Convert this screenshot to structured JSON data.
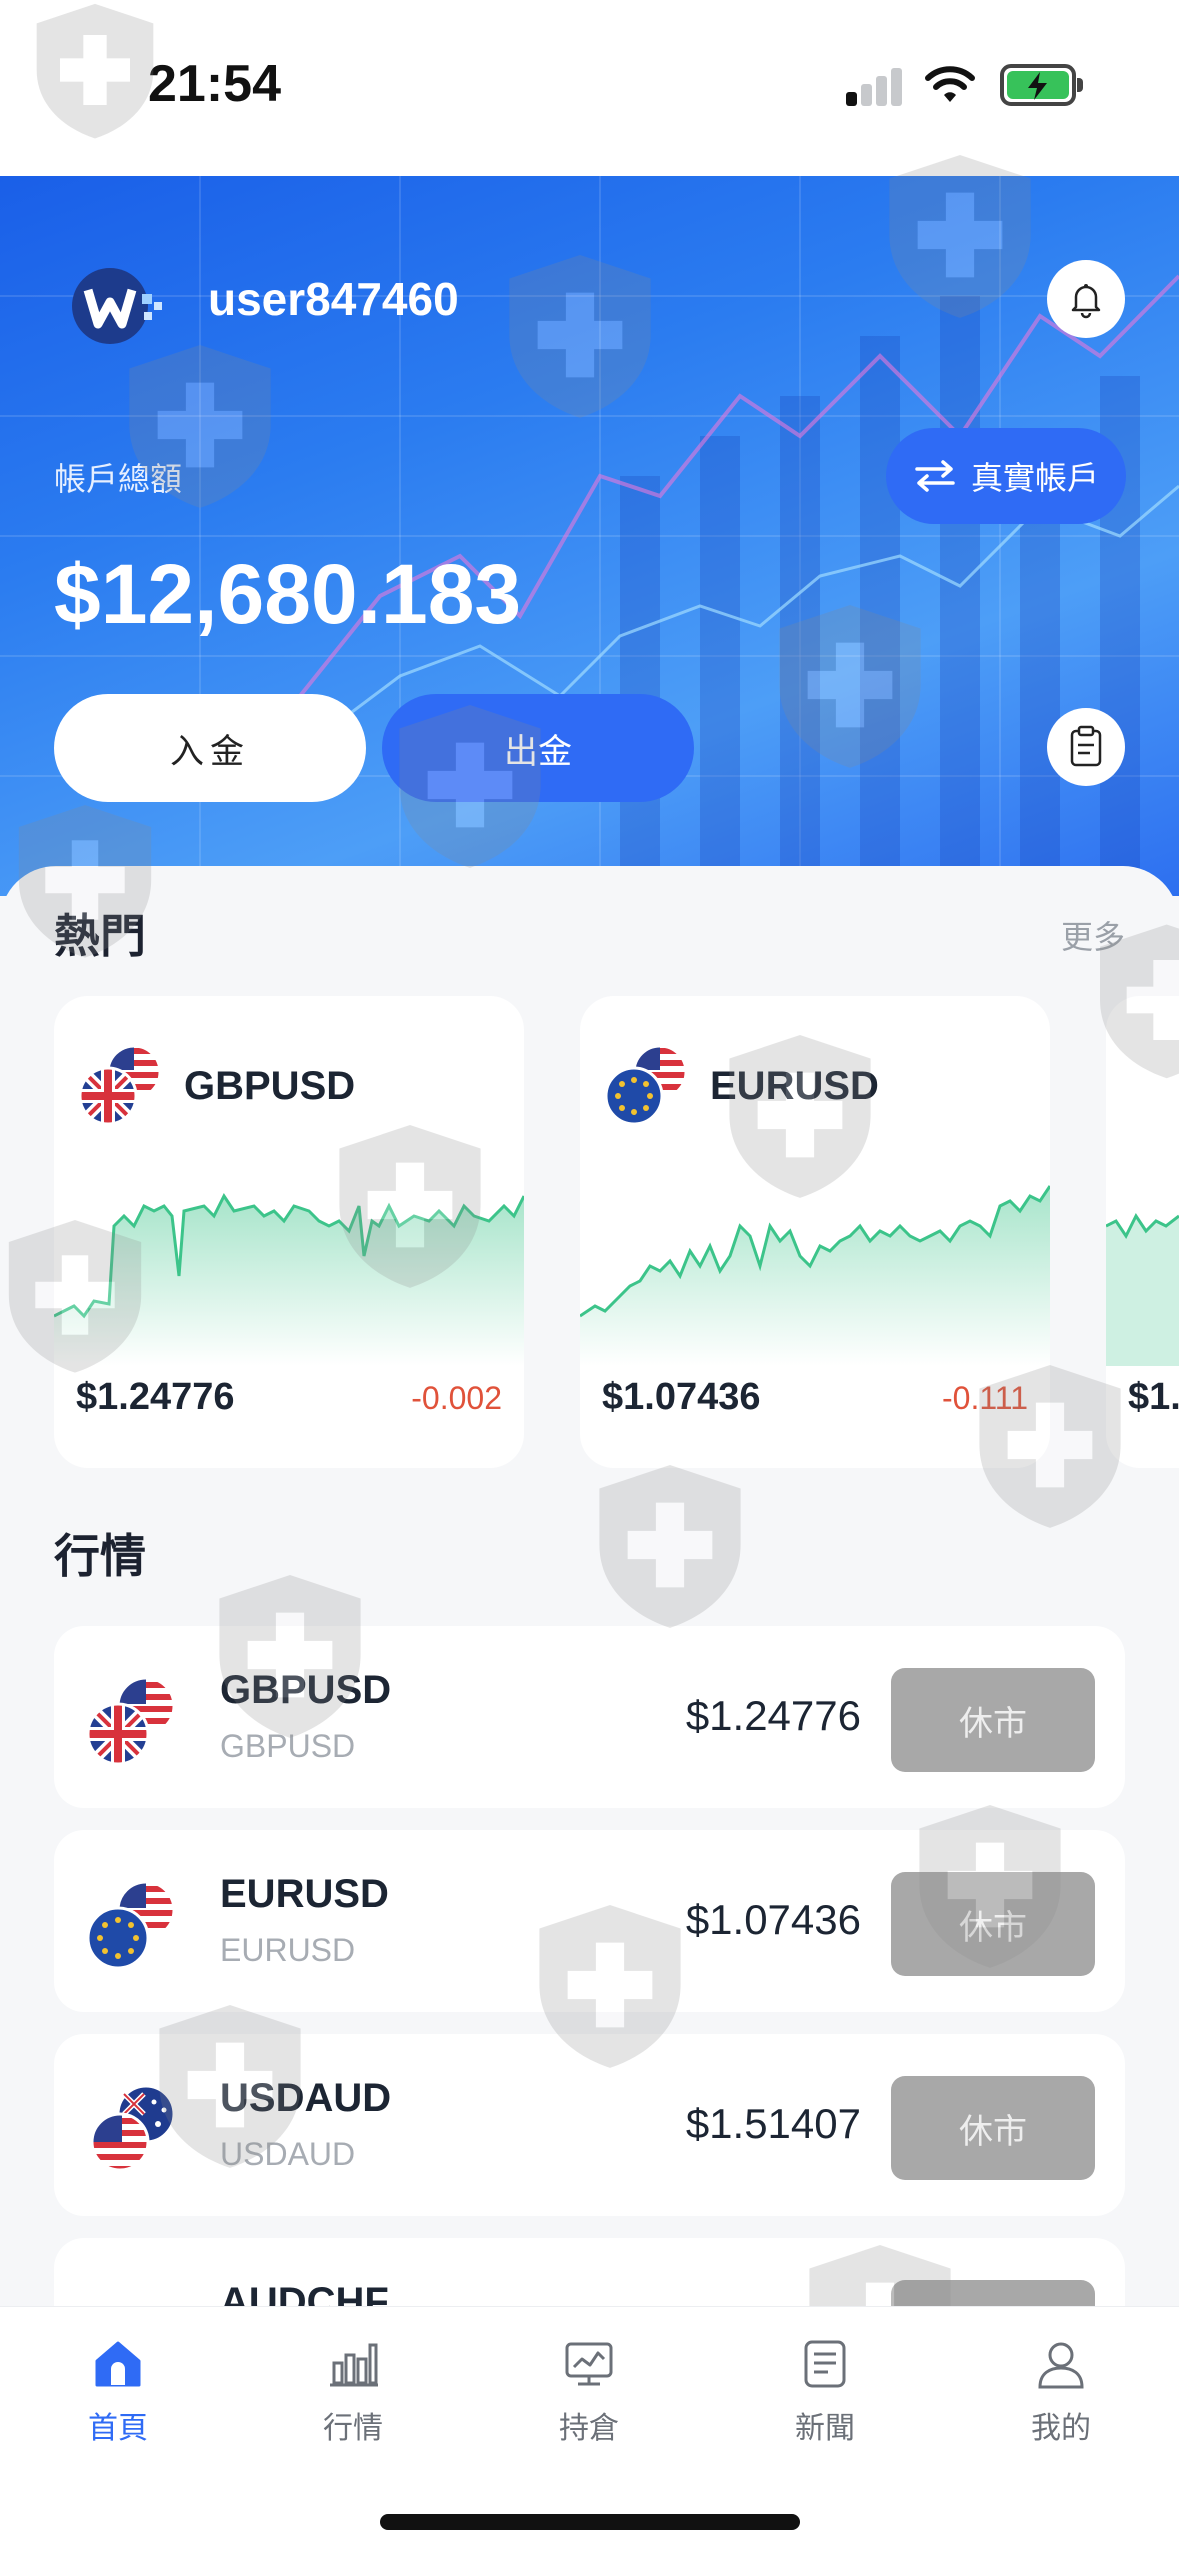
{
  "status_bar": {
    "time": "21:54"
  },
  "header": {
    "username": "user847460",
    "balance_label": "帳戶總額",
    "balance": "$12,680.183",
    "account_switch_label": "真實帳戶",
    "deposit_label": "入金",
    "withdraw_label": "出金"
  },
  "hot": {
    "title": "熱門",
    "more_label": "更多",
    "cards": [
      {
        "pair": "GBPUSD",
        "price": "$1.24776",
        "change": "-0.002"
      },
      {
        "pair": "EURUSD",
        "price": "$1.07436",
        "change": "-0.111"
      },
      {
        "price": "$1."
      }
    ]
  },
  "market": {
    "title": "行情",
    "rows": [
      {
        "symbol": "GBPUSD",
        "subtitle": "GBPUSD",
        "price": "$1.24776",
        "status": "休市"
      },
      {
        "symbol": "EURUSD",
        "subtitle": "EURUSD",
        "price": "$1.07436",
        "status": "休市"
      },
      {
        "symbol": "USDAUD",
        "subtitle": "USDAUD",
        "price": "$1.51407",
        "status": "休市"
      },
      {
        "symbol": "AUDCHF"
      }
    ]
  },
  "tabs": [
    {
      "label": "首頁",
      "icon": "home-icon",
      "active": true
    },
    {
      "label": "行情",
      "icon": "bar-chart-icon",
      "active": false
    },
    {
      "label": "持倉",
      "icon": "monitor-chart-icon",
      "active": false
    },
    {
      "label": "新聞",
      "icon": "news-icon",
      "active": false
    },
    {
      "label": "我的",
      "icon": "user-icon",
      "active": false
    }
  ],
  "colors": {
    "accent": "#2f6bf5",
    "negative": "#e0523a",
    "closed_button": "#a8a8a8",
    "spark_line": "#3cc48a"
  }
}
